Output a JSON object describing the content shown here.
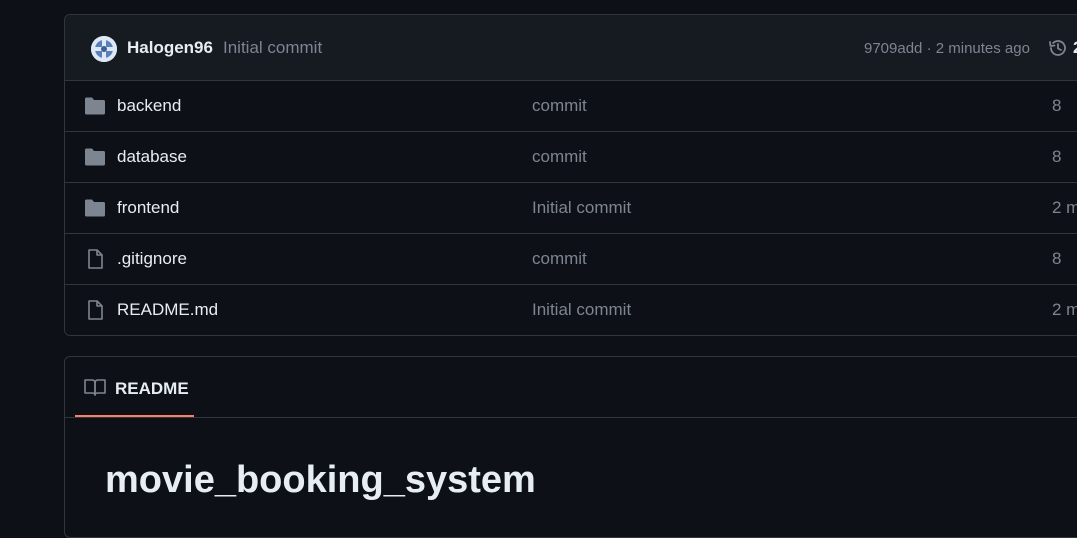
{
  "latest_commit": {
    "author": "Halogen96",
    "message": "Initial commit",
    "meta": "9709add · 2 minutes ago",
    "history_count": "2"
  },
  "files": [
    {
      "name": "backend",
      "type": "folder",
      "commit": "commit",
      "age": "8"
    },
    {
      "name": "database",
      "type": "folder",
      "commit": "commit",
      "age": "8"
    },
    {
      "name": "frontend",
      "type": "folder",
      "commit": "Initial commit",
      "age": "2 m"
    },
    {
      "name": ".gitignore",
      "type": "file",
      "commit": "commit",
      "age": "8"
    },
    {
      "name": "README.md",
      "type": "file",
      "commit": "Initial commit",
      "age": "2 m"
    }
  ],
  "readme": {
    "tab_label": "README",
    "title": "movie_booking_system"
  },
  "colors": {
    "background": "#0d1117",
    "border": "#30363d",
    "muted_text": "#7d8590",
    "tab_underline": "#f78166"
  },
  "icons": {
    "folder": "folder-icon",
    "file": "file-icon",
    "history": "history-icon",
    "readme": "book-icon"
  }
}
